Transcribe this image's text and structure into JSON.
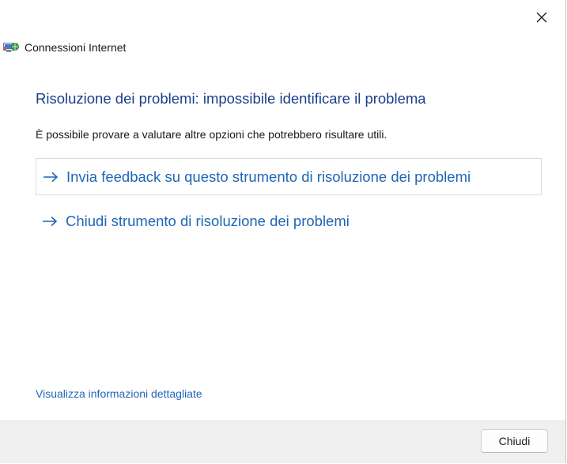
{
  "window": {
    "app_name": "Connessioni Internet",
    "close_icon": "close-icon"
  },
  "main": {
    "title": "Risoluzione dei problemi: impossibile identificare il problema",
    "description": "È possibile provare a valutare altre opzioni che potrebbero risultare utili.",
    "options": [
      {
        "label": "Invia feedback su questo strumento di risoluzione dei problemi",
        "icon": "arrow-right-icon"
      },
      {
        "label": "Chiudi strumento di risoluzione dei problemi",
        "icon": "arrow-right-icon"
      }
    ],
    "details_link": "Visualizza informazioni dettagliate"
  },
  "footer": {
    "close_button": "Chiudi"
  },
  "colors": {
    "title": "#1a3f8c",
    "link": "#1f66b5",
    "footer_bg": "#f0f0f0"
  }
}
